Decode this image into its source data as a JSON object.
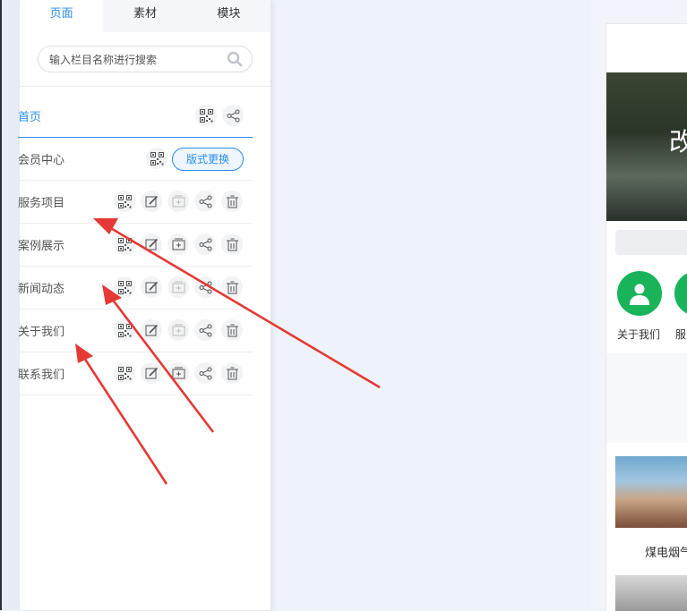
{
  "tabs": [
    {
      "label": "页面",
      "active": true
    },
    {
      "label": "素材",
      "active": false
    },
    {
      "label": "模块",
      "active": false
    }
  ],
  "search": {
    "placeholder": "输入栏目名称进行搜索"
  },
  "pages": [
    {
      "name": "首页",
      "active": true
    },
    {
      "name": "会员中心",
      "button": "版式更换"
    },
    {
      "name": "服务项目"
    },
    {
      "name": "案例展示"
    },
    {
      "name": "新闻动态"
    },
    {
      "name": "关于我们"
    },
    {
      "name": "联系我们"
    }
  ],
  "icons": {
    "qrcode": "qrcode-icon",
    "edit": "edit-icon",
    "copy": "copy-page-icon",
    "share": "share-icon",
    "delete": "trash-icon"
  },
  "preview": {
    "banner_text": "改",
    "nav_items": [
      "关于我们",
      "服"
    ],
    "news_caption": "煤电烟气"
  },
  "colors": {
    "accent": "#2b8ff0",
    "arrow": "#e53935",
    "nav_green": "#19b35a"
  }
}
